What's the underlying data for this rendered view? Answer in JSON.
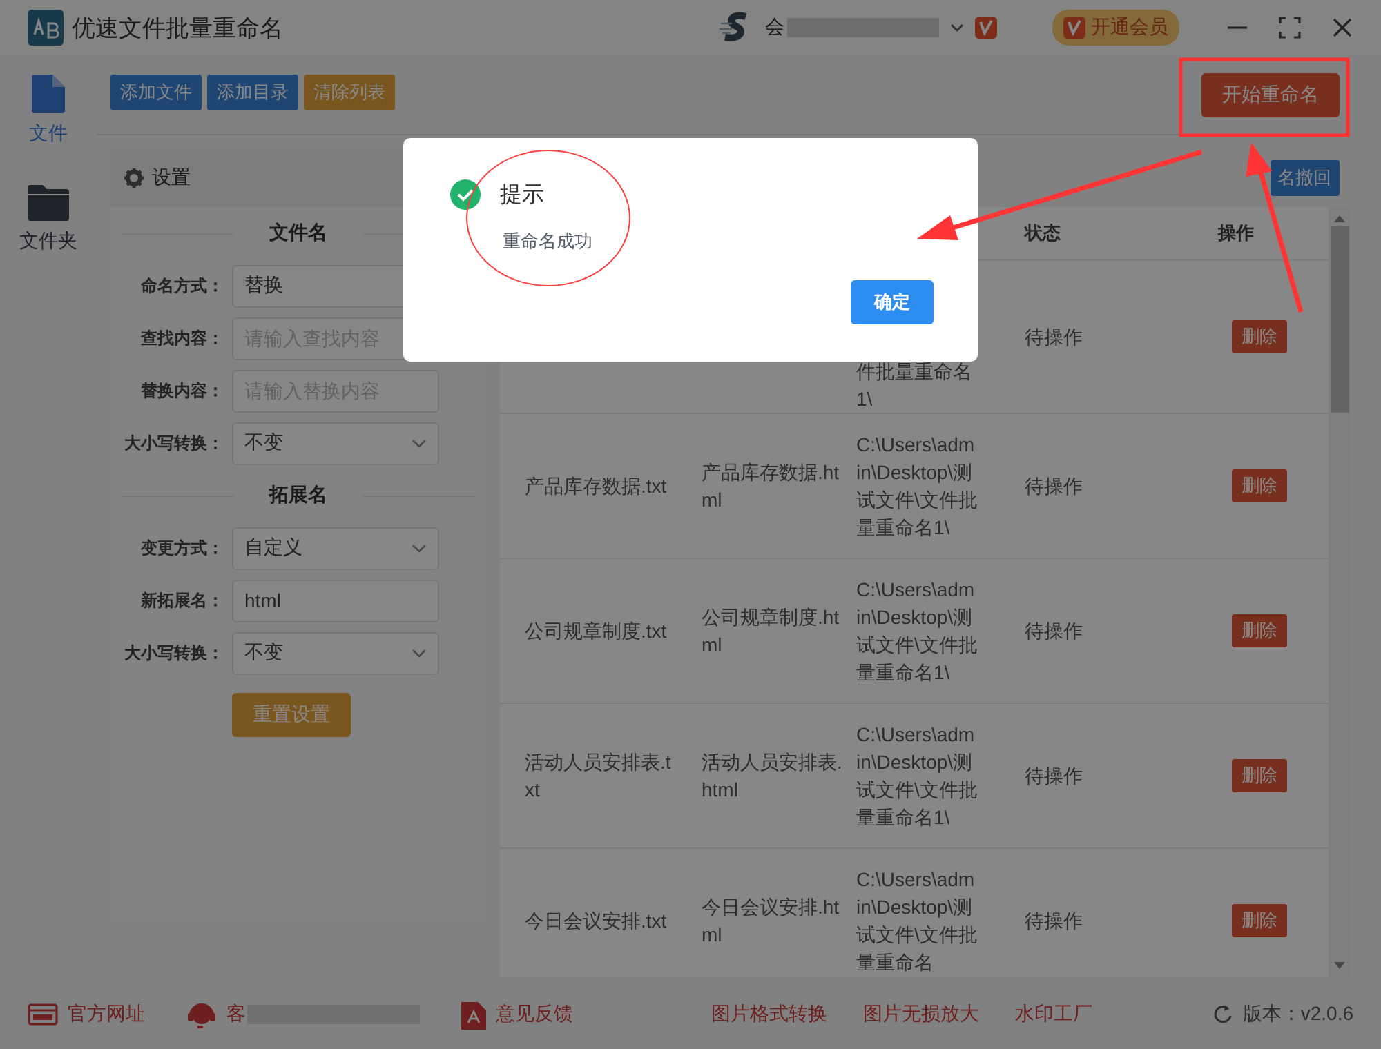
{
  "window": {
    "title": "优速文件批量重命名",
    "account": "会",
    "vip_button": "开通会员"
  },
  "toolbar": {
    "buttons": [
      {
        "label": "添加文件",
        "kind": "primary"
      },
      {
        "label": "添加目录",
        "kind": "primary"
      },
      {
        "label": "清除列表",
        "kind": "warning"
      }
    ],
    "start_button": "开始重命名"
  },
  "sidebar": {
    "items": [
      {
        "label": "文件",
        "selected": true,
        "kind": "file"
      },
      {
        "label": "文件夹",
        "selected": false,
        "kind": "folder"
      }
    ]
  },
  "settings": {
    "title": "设置",
    "sections": [
      {
        "title": "文件名",
        "fields": [
          {
            "label": "命名方式：",
            "kind": "text",
            "value": "替换"
          },
          {
            "label": "查找内容：",
            "kind": "text",
            "placeholder": "请输入查找内容"
          },
          {
            "label": "替换内容：",
            "kind": "text",
            "placeholder": "请输入替换内容"
          },
          {
            "label": "大小写转换：",
            "kind": "select",
            "value": "不变"
          }
        ]
      },
      {
        "title": "拓展名",
        "fields": [
          {
            "label": "变更方式：",
            "kind": "select",
            "value": "自定义"
          },
          {
            "label": "新拓展名：",
            "kind": "text",
            "value": "html"
          },
          {
            "label": "大小写转换：",
            "kind": "select",
            "value": "不变"
          }
        ]
      }
    ],
    "reset_button": "重置设置"
  },
  "table": {
    "undo_button": "名撤回",
    "columns": [
      {
        "label": "状态"
      },
      {
        "label": "操作"
      }
    ],
    "rows": [
      {
        "path": "件批量重命名1\\",
        "status": "待操作",
        "action": "删除"
      },
      {
        "name": "产品库存数据.txt",
        "new_name": "产品库存数据.html",
        "path": "C:\\Users\\admin\\Desktop\\测试文件\\文件批量重命名1\\",
        "status": "待操作",
        "action": "删除"
      },
      {
        "name": "公司规章制度.txt",
        "new_name": "公司规章制度.html",
        "path": "C:\\Users\\admin\\Desktop\\测试文件\\文件批量重命名1\\",
        "status": "待操作",
        "action": "删除"
      },
      {
        "name": "活动人员安排表.txt",
        "new_name": "活动人员安排表.html",
        "path": "C:\\Users\\admin\\Desktop\\测试文件\\文件批量重命名1\\",
        "status": "待操作",
        "action": "删除"
      },
      {
        "name": "今日会议安排.txt",
        "new_name": "今日会议安排.html",
        "path": "C:\\Users\\admin\\Desktop\\测试文件\\文件批量重命名",
        "status": "待操作",
        "action": "删除"
      }
    ]
  },
  "footer": {
    "website": "官方网址",
    "service": "客",
    "feedback": "意见反馈",
    "links": [
      "图片格式转换",
      "图片无损放大",
      "水印工厂"
    ],
    "version": "版本：v2.0.6"
  },
  "dialog": {
    "title": "提示",
    "message": "重命名成功",
    "ok_button": "确定"
  }
}
